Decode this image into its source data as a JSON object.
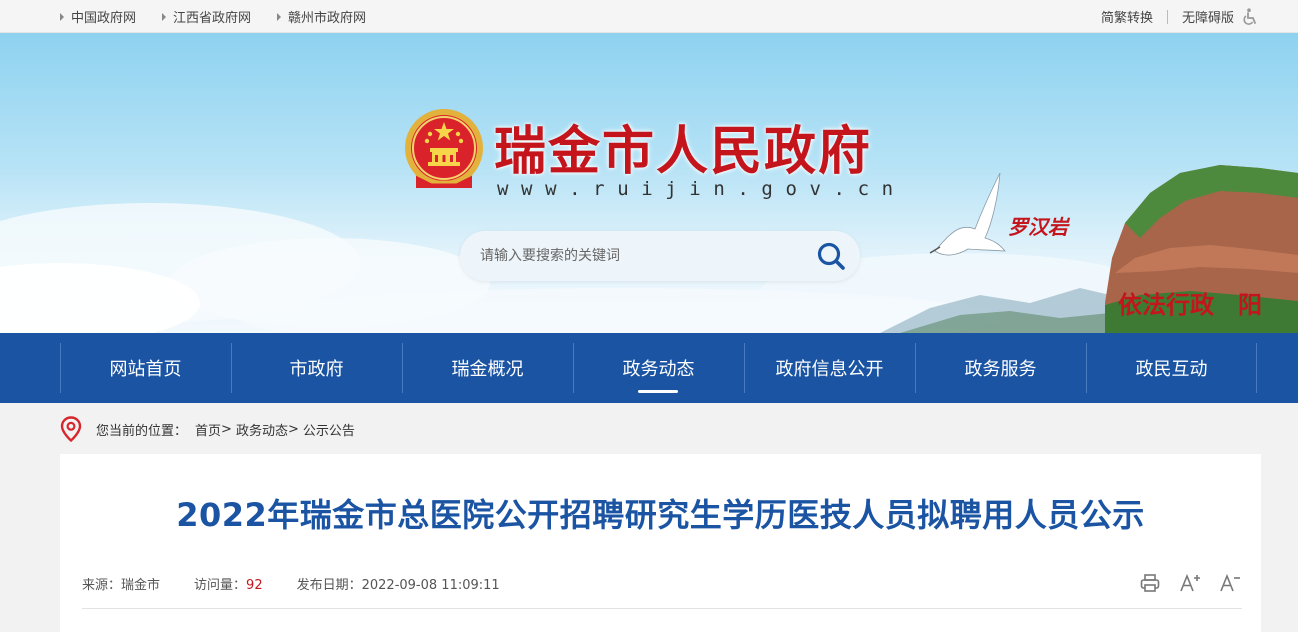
{
  "topbar": {
    "links": [
      "中国政府网",
      "江西省政府网",
      "赣州市政府网"
    ],
    "lang_toggle": "简繁转换",
    "accessibility": "无障碍版"
  },
  "header": {
    "site_title": "瑞金市人民政府",
    "site_url": "www.ruijin.gov.cn",
    "search_placeholder": "请输入要搜索的关键词",
    "scenic_name": "罗汉岩",
    "slogan": "依法行政　阳"
  },
  "nav": {
    "items": [
      "网站首页",
      "市政府",
      "瑞金概况",
      "政务动态",
      "政府信息公开",
      "政务服务",
      "政民互动"
    ],
    "active": "政务动态"
  },
  "breadcrumb": {
    "label": "您当前的位置：",
    "items": [
      "首页",
      "政务动态",
      "公示公告"
    ],
    "sep": ">"
  },
  "article": {
    "title": "2022年瑞金市总医院公开招聘研究生学历医技人员拟聘用人员公示",
    "source_label": "来源：",
    "source": "瑞金市",
    "hits_label": "访问量：",
    "hits": "92",
    "date_label": "发布日期：",
    "date": "2022-09-08 11:09:11"
  },
  "icons": {
    "print": "print-icon",
    "font_larger": "font-increase-icon",
    "font_smaller": "font-decrease-icon",
    "search": "search-icon",
    "location": "location-pin-icon",
    "accessibility": "wheelchair-icon"
  },
  "colors": {
    "brand_red": "#c4151c",
    "nav_blue": "#1a54a3",
    "title_blue": "#1a54a3"
  }
}
